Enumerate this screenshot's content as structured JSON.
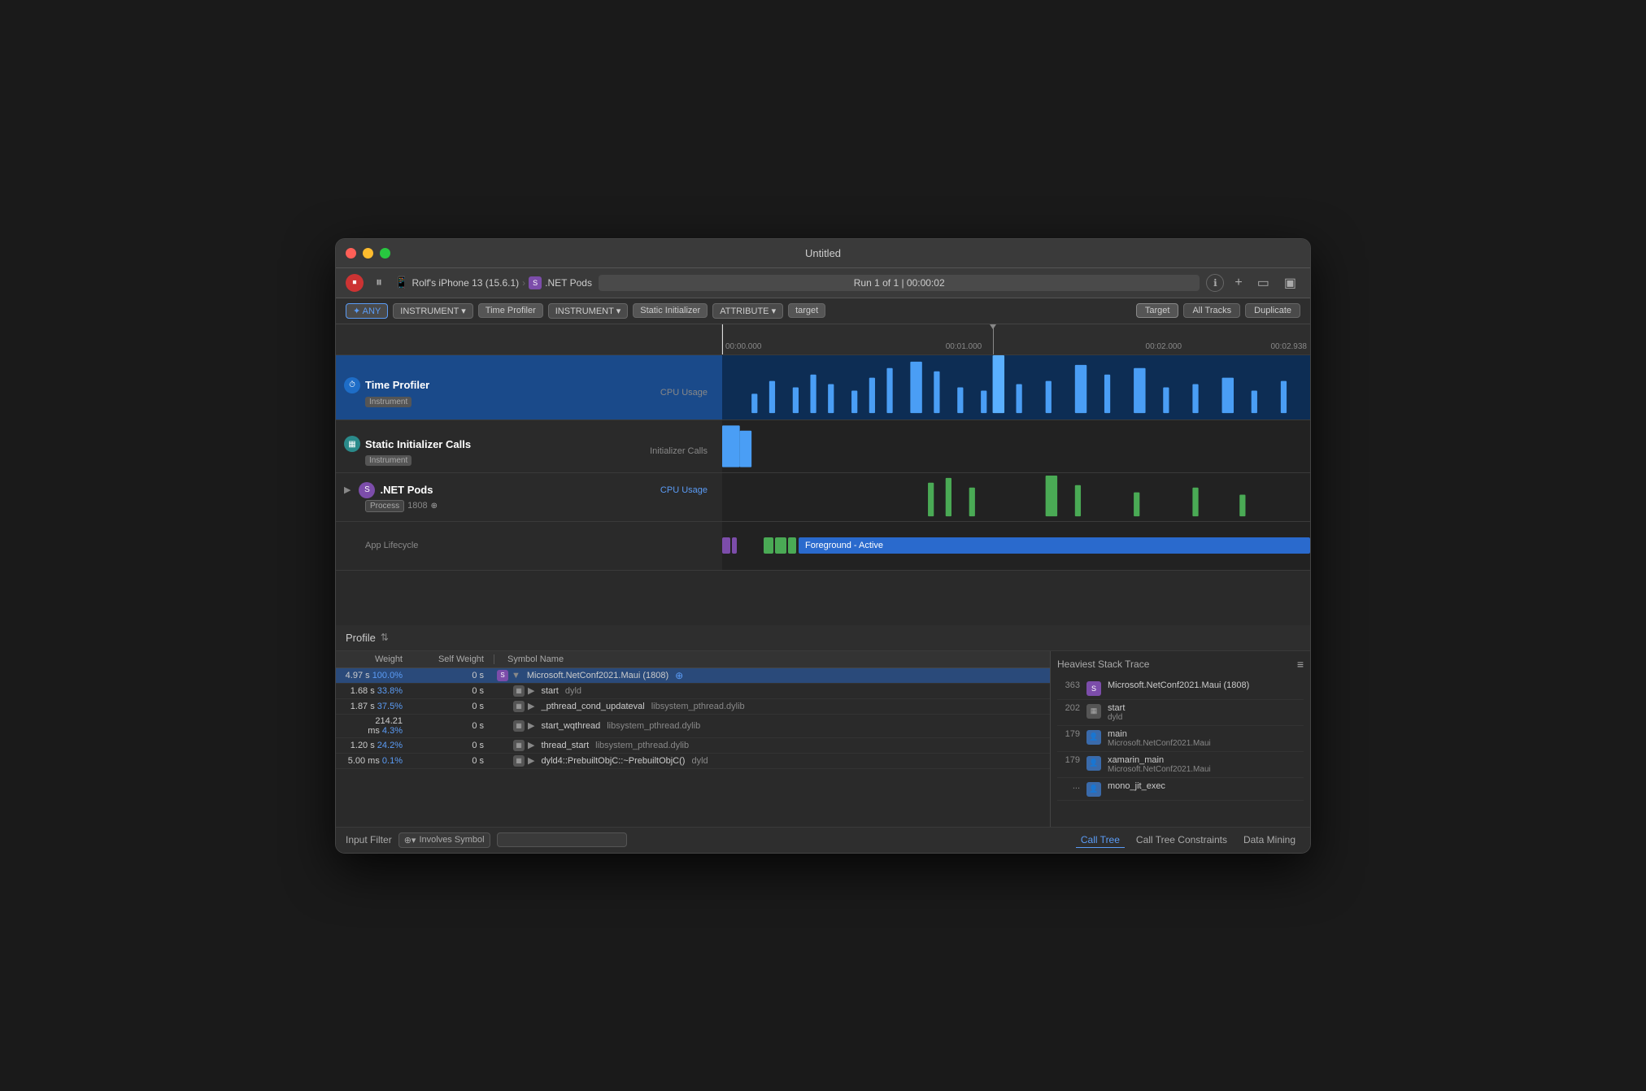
{
  "window": {
    "title": "Untitled"
  },
  "toolbar": {
    "stop_label": "⏹",
    "pause_label": "⏸",
    "device": "Rolf's iPhone 13 (15.6.1)",
    "target": ".NET Pods",
    "run_info": "Run 1 of 1  |  00:00:02",
    "add_label": "+",
    "layout1": "▭",
    "layout2": "▣"
  },
  "filter_bar": {
    "any_label": "✦ ANY",
    "instrument1": "INSTRUMENT ▾",
    "time_profiler": "Time Profiler",
    "instrument2": "INSTRUMENT ▾",
    "static_initializer": "Static Initializer",
    "attribute": "ATTRIBUTE ▾",
    "target": "target",
    "target_btn": "Target",
    "all_tracks": "All Tracks",
    "duplicate": "Duplicate"
  },
  "timeline": {
    "markers": [
      "00:00.000",
      "00:01.000",
      "00:02.000",
      "00:02.938"
    ]
  },
  "tracks": [
    {
      "id": "time-profiler",
      "name": "Time Profiler",
      "badge": "Instrument",
      "sublabel": "CPU Usage",
      "sublabel_color": "gray",
      "icon_color": "blue",
      "icon_text": "⏱"
    },
    {
      "id": "static-initializer",
      "name": "Static Initializer Calls",
      "badge": "Instrument",
      "sublabel": "Initializer Calls",
      "sublabel_color": "gray",
      "icon_color": "teal",
      "icon_text": "▦"
    },
    {
      "id": "net-pods",
      "name": ".NET Pods",
      "badge": "Process",
      "badge_extra": "1808",
      "sublabel": "CPU Usage",
      "sublabel_color": "blue",
      "sublabel2": "App Lifecycle",
      "icon_color": "purple",
      "icon_text": "S",
      "expanded": true
    }
  ],
  "lifecycle": {
    "label": "Foreground - Active"
  },
  "bottom_panel": {
    "profile_label": "Profile",
    "chevron": "⇅"
  },
  "table": {
    "headers": {
      "weight": "Weight",
      "self_weight": "Self Weight",
      "symbol": "Symbol Name"
    },
    "rows": [
      {
        "weight": "4.97 s",
        "weight_pct": "100.0%",
        "self_weight": "0 s",
        "icon": "purple",
        "expanded": true,
        "symbol": "Microsoft.NetConf2021.Maui (1808)",
        "has_nav": true
      },
      {
        "weight": "1.68 s",
        "weight_pct": "33.8%",
        "self_weight": "0 s",
        "icon": "gray",
        "symbol": "start",
        "symbol_sub": "dyld",
        "indent": 1
      },
      {
        "weight": "1.87 s",
        "weight_pct": "37.5%",
        "self_weight": "0 s",
        "icon": "gray",
        "symbol": "_pthread_cond_updateval",
        "symbol_sub": "libsystem_pthread.dylib",
        "indent": 1
      },
      {
        "weight": "214.21 ms",
        "weight_pct": "4.3%",
        "self_weight": "0 s",
        "icon": "gray",
        "symbol": "start_wqthread",
        "symbol_sub": "libsystem_pthread.dylib",
        "indent": 1
      },
      {
        "weight": "1.20 s",
        "weight_pct": "24.2%",
        "self_weight": "0 s",
        "icon": "gray",
        "symbol": "thread_start",
        "symbol_sub": "libsystem_pthread.dylib",
        "indent": 1
      },
      {
        "weight": "5.00 ms",
        "weight_pct": "0.1%",
        "self_weight": "0 s",
        "icon": "gray",
        "symbol": "dyld4::PrebuiltObjC::~PrebuiltObjC()",
        "symbol_sub": "dyld",
        "indent": 1
      }
    ]
  },
  "stack_trace": {
    "title": "Heaviest Stack Trace",
    "items": [
      {
        "count": "363",
        "icon": "purple",
        "func": "Microsoft.NetConf2021.Maui (1808)",
        "lib": ""
      },
      {
        "count": "202",
        "icon": "gray",
        "func": "start",
        "lib": "dyld"
      },
      {
        "count": "179",
        "icon": "blue",
        "func": "main",
        "lib": "Microsoft.NetConf2021.Maui"
      },
      {
        "count": "179",
        "icon": "blue",
        "func": "xamarin_main",
        "lib": "Microsoft.NetConf2021.Maui"
      },
      {
        "count": "...",
        "icon": "blue",
        "func": "mono_jit_exec",
        "lib": ""
      }
    ]
  },
  "bottom_toolbar": {
    "input_filter": "Input Filter",
    "involves_symbol": "Involves Symbol",
    "call_tree": "Call Tree",
    "call_tree_constraints": "Call Tree Constraints",
    "data_mining": "Data Mining"
  }
}
